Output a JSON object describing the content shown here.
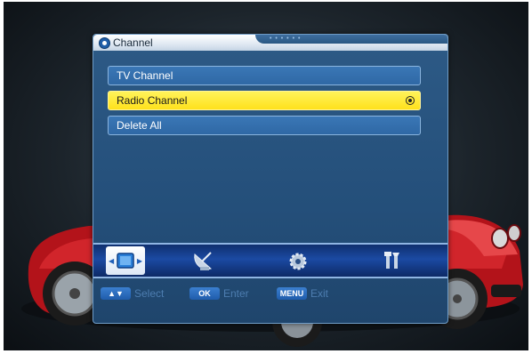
{
  "window": {
    "title": "Channel"
  },
  "menu": {
    "items": [
      {
        "label": "TV Channel",
        "selected": false
      },
      {
        "label": "Radio Channel",
        "selected": true
      },
      {
        "label": "Delete All",
        "selected": false
      }
    ]
  },
  "icon_bar": {
    "icons": [
      "tv-icon",
      "satellite-dish-icon",
      "gear-icon",
      "tools-icon"
    ],
    "active_index": 0
  },
  "hints": {
    "select_key": "▲▼",
    "select_label": "Select",
    "ok_key": "OK",
    "ok_label": "Enter",
    "menu_key": "MENU",
    "menu_label": "Exit"
  },
  "colors": {
    "selected_item": "#ffe11c",
    "item_normal": "#2f68a5",
    "panel": "#244f7a",
    "hint_text": "#4d7db0"
  }
}
